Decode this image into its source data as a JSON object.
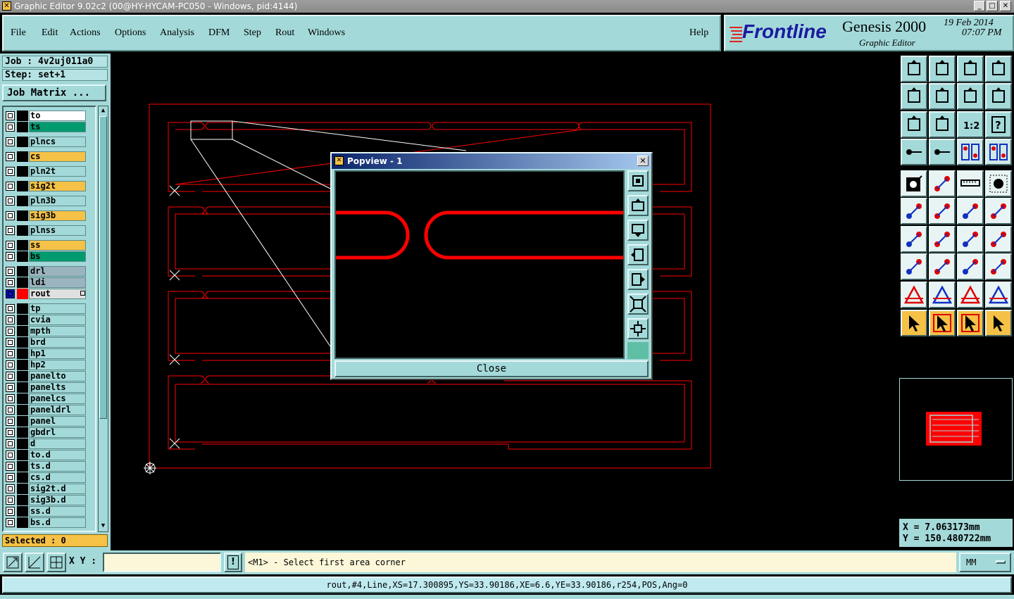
{
  "window": {
    "title": "Graphic Editor 9.02c2 (00@HY-HYCAM-PC050 - Windows, pid:4144)"
  },
  "menu": {
    "items": [
      "File",
      "Edit",
      "Actions",
      "Options",
      "Analysis",
      "DFM",
      "Step",
      "Rout",
      "Windows"
    ],
    "help": "Help"
  },
  "brand": {
    "logo": "Frontline",
    "product": "Genesis 2000",
    "subtitle": "Graphic Editor",
    "date": "19 Feb 2014",
    "time": "07:07 PM"
  },
  "job": {
    "job_label": "Job : 4v2uj011a0",
    "step_label": "Step: set+1",
    "matrix_button": "Job Matrix ..."
  },
  "layers": [
    {
      "name": "to",
      "bg": "#ffffff",
      "sw": "#000000"
    },
    {
      "name": "ts",
      "bg": "#009a6e",
      "sw": "#000000"
    },
    {
      "name": "plncs",
      "bg": "#a4d9d9",
      "sw": "#000000"
    },
    {
      "name": "cs",
      "bg": "#f5c146",
      "sw": "#000000"
    },
    {
      "name": "pln2t",
      "bg": "#a4d9d9",
      "sw": "#000000"
    },
    {
      "name": "sig2t",
      "bg": "#f5c146",
      "sw": "#000000"
    },
    {
      "name": "pln3b",
      "bg": "#a4d9d9",
      "sw": "#000000"
    },
    {
      "name": "sig3b",
      "bg": "#f5c146",
      "sw": "#000000"
    },
    {
      "name": "plnss",
      "bg": "#a4d9d9",
      "sw": "#000000"
    },
    {
      "name": "ss",
      "bg": "#f5c146",
      "sw": "#000000"
    },
    {
      "name": "bs",
      "bg": "#009a6e",
      "sw": "#000000"
    },
    {
      "name": "drl",
      "bg": "#9bb4bf",
      "sw": "#000000"
    },
    {
      "name": "ldi",
      "bg": "#9bb4bf",
      "sw": "#000000"
    },
    {
      "name": "rout",
      "bg": "#e0e0e0",
      "sw": "#ff0000",
      "active": true
    },
    {
      "name": "tp",
      "bg": "#a4d9d9",
      "sw": "#000000"
    },
    {
      "name": "cvia",
      "bg": "#a4d9d9",
      "sw": "#000000"
    },
    {
      "name": "mpth",
      "bg": "#a4d9d9",
      "sw": "#000000"
    },
    {
      "name": "brd",
      "bg": "#a4d9d9",
      "sw": "#000000"
    },
    {
      "name": "hp1",
      "bg": "#a4d9d9",
      "sw": "#000000"
    },
    {
      "name": "hp2",
      "bg": "#a4d9d9",
      "sw": "#000000"
    },
    {
      "name": "panelto",
      "bg": "#a4d9d9",
      "sw": "#000000"
    },
    {
      "name": "panelts",
      "bg": "#a4d9d9",
      "sw": "#000000"
    },
    {
      "name": "panelcs",
      "bg": "#a4d9d9",
      "sw": "#000000"
    },
    {
      "name": "paneldrl",
      "bg": "#a4d9d9",
      "sw": "#000000"
    },
    {
      "name": "panel",
      "bg": "#a4d9d9",
      "sw": "#000000"
    },
    {
      "name": "gbdrl",
      "bg": "#a4d9d9",
      "sw": "#000000"
    },
    {
      "name": "d",
      "bg": "#a4d9d9",
      "sw": "#000000"
    },
    {
      "name": "to.d",
      "bg": "#a4d9d9",
      "sw": "#000000"
    },
    {
      "name": "ts.d",
      "bg": "#a4d9d9",
      "sw": "#000000"
    },
    {
      "name": "cs.d",
      "bg": "#a4d9d9",
      "sw": "#000000"
    },
    {
      "name": "sig2t.d",
      "bg": "#a4d9d9",
      "sw": "#000000"
    },
    {
      "name": "sig3b.d",
      "bg": "#a4d9d9",
      "sw": "#000000"
    },
    {
      "name": "ss.d",
      "bg": "#a4d9d9",
      "sw": "#000000"
    },
    {
      "name": "bs.d",
      "bg": "#a4d9d9",
      "sw": "#000000"
    }
  ],
  "selected": "Selected : 0",
  "popview": {
    "title": "Popview - 1",
    "close_label": "Close"
  },
  "coords": {
    "x": "X =  7.063173mm",
    "y": "Y = 150.480722mm"
  },
  "bottom": {
    "xy_label": "X Y :",
    "xy_value": "",
    "prompt": "<M1> - Select first area corner",
    "units": "MM",
    "status": "rout,#4,Line,XS=17.300895,YS=33.90186,XE=6.6,YE=33.90186,r254,POS,Ang=0"
  },
  "colors": {
    "panel": "#a4d9d9",
    "route": "#ff0000",
    "canvas": "#000000",
    "highlight": "#f5c146"
  }
}
